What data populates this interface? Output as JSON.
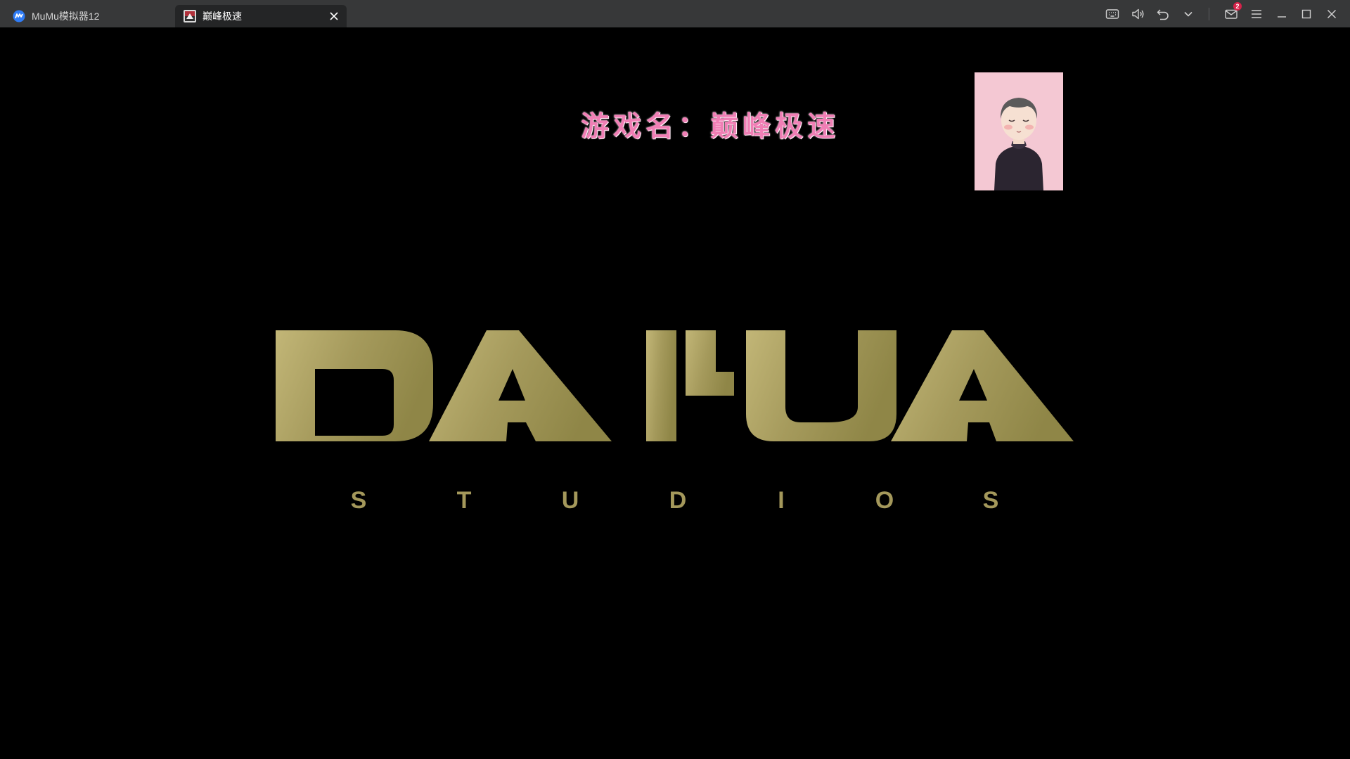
{
  "tabs": [
    {
      "label": "MuMu模拟器12",
      "icon": "mumu-logo-icon",
      "active": false
    },
    {
      "label": "巅峰极速",
      "icon": "game-thumbnail-icon",
      "active": true
    }
  ],
  "toolbar": {
    "icons": [
      "keyboard-icon",
      "volume-icon",
      "back-icon",
      "chevron-down-icon",
      "mail-icon",
      "menu-icon",
      "minimize-icon",
      "maximize-icon",
      "close-icon"
    ],
    "mail_badge": "2"
  },
  "game": {
    "caption": "游戏名：巅峰极速",
    "logo_text": "DAHUA",
    "logo_sub": [
      "S",
      "T",
      "U",
      "D",
      "I",
      "O",
      "S"
    ],
    "logo_color": "#a89d60"
  },
  "colors": {
    "titlebar": "#373839",
    "active_tab": "#242526",
    "caption": "#f07fb5",
    "avatar_bg": "#f4c8d3"
  }
}
